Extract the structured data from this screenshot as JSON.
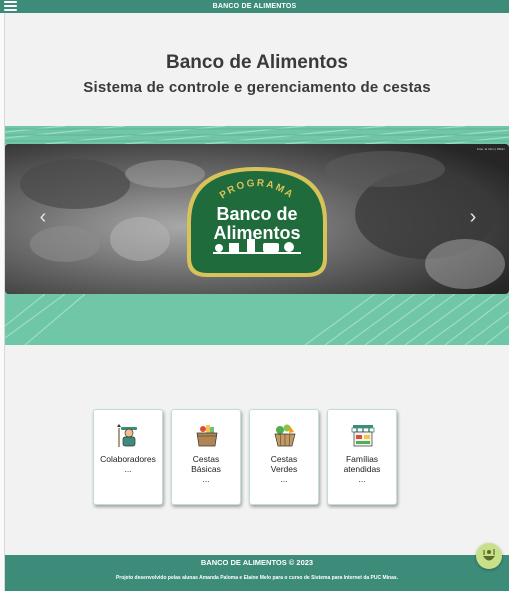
{
  "topbar": {
    "title": "BANCO DE ALIMENTOS",
    "menu_icon": "hamburger-menu-icon"
  },
  "hero": {
    "title": "Banco de Alimentos",
    "subtitle": "Sistema de controle e gerenciamento de cestas"
  },
  "carousel": {
    "logo_arc_text": "PROGRAMA",
    "logo_line1": "Banco de",
    "logo_line2": "Alimentos",
    "credit": "Foto: la Vinci | Wikim",
    "prev_icon": "chevron-left-icon",
    "next_icon": "chevron-right-icon",
    "colors": {
      "banner": "#6fc7a7",
      "logo_green": "#1f6b3c",
      "logo_border": "#d8c25a"
    }
  },
  "cards": [
    {
      "label_lines": [
        "Colaboradores"
      ],
      "value": "...",
      "icon": "farmer-icon"
    },
    {
      "label_lines": [
        "Cestas",
        "Básicas"
      ],
      "value": "...",
      "icon": "grocery-box-icon"
    },
    {
      "label_lines": [
        "Cestas",
        "Verdes"
      ],
      "value": "...",
      "icon": "vegetable-basket-icon"
    },
    {
      "label_lines": [
        "Famílias",
        "atendidas"
      ],
      "value": "...",
      "icon": "market-stall-icon"
    }
  ],
  "footer": {
    "title": "BANCO DE ALIMENTOS © 2023",
    "note": "Projeto desenvolvido pelas alunas Amanda Paloma e Elaine Melo para o curso de Sistema para Internet da PUC Minas."
  },
  "chat_button_icon": "food-bowl-icon",
  "colors": {
    "primary": "#3d8c7a",
    "page_bg": "#f2f2f2",
    "card_border": "#bfe0d2"
  }
}
